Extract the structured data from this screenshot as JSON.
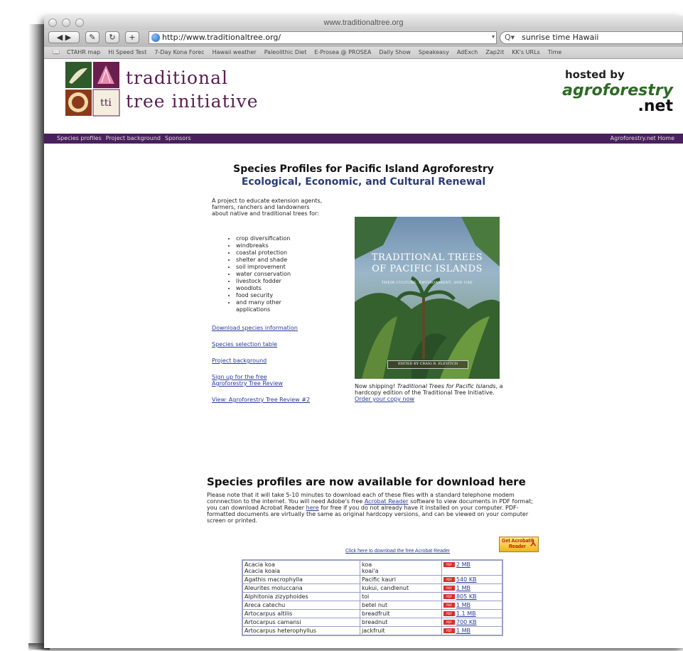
{
  "window": {
    "title": "www.traditionaltree.org",
    "back_label": "◀ ▶",
    "address": "http://www.traditionaltree.org/",
    "search": "sunrise time Hawaii"
  },
  "bookmarks": [
    "CTAHR map",
    "Hi Speed Test",
    "7-Day Kona Forec",
    "Hawaii weather",
    "Paleolithic Diet",
    "E-Prosea @ PROSEA",
    "Daily Show",
    "Speakeasy",
    "AdExch",
    "Zap2it",
    "KK's URLs",
    "Time"
  ],
  "header": {
    "logo_line1": "traditional",
    "logo_line2": "tree initiative",
    "hosted_by": "hosted by",
    "agro_name": "agroforestry",
    "agro_tld": ".net"
  },
  "nav": {
    "items": [
      "Species profiles",
      "Project background",
      "Sponsors"
    ],
    "right": "Agroforestry.net Home"
  },
  "main": {
    "title": "Species Profiles for Pacific Island Agroforestry",
    "subtitle": "Ecological, Economic, and Cultural Renewal",
    "intro": "A project to educate extension agents, farmers, ranchers and landowners about native and traditional trees for:",
    "uses": [
      "crop diversification",
      "windbreaks",
      "coastal protection",
      "shelter and shade",
      "soil improvement",
      "water conservation",
      "livestock fodder",
      "woodlots",
      "food security",
      "and many other applications"
    ],
    "links": [
      "Download species information",
      "Species selection table",
      "Project background",
      "Sign up for the free Agroforestry Tree Review",
      "View: Agroforestry Tree Review #2"
    ]
  },
  "book": {
    "title": "TRADITIONAL TREES OF PACIFIC ISLANDS",
    "subtitle": "THEIR CULTURE, ENVIRONMENT, AND USE",
    "editor": "EDITED BY CRAIG R. ELEVITCH",
    "caption_prefix": "Now shipping! ",
    "caption_title": "Traditional Trees for Pacific Islands",
    "caption_mid": ", a hardcopy edition of the Traditional Tree Initiative. ",
    "caption_link": "Order your copy now"
  },
  "download": {
    "title": "Species profiles are now available for download here",
    "note_1": "Please note that it will take 5-10 minutes to download each of these files with a standard telephone modem connnection to the internet. You will need Adobe's free ",
    "note_link1": "Acrobat Reader",
    "note_2": " software to view documents in PDF format; you can download Acrobat Reader ",
    "note_link2": "here",
    "note_3": " for free if you do not already have it installed on your computer. PDF-formatted documents are virtually the same as original hardcopy versions, and can be viewed on your computer screen or printed.",
    "acrobat_link": "Click here to download the free Acrobat Reader",
    "acrobat_badge_1": "Get Acrobat®",
    "acrobat_badge_2": "Reader",
    "pdf_badge": "PDF"
  },
  "species": [
    {
      "sci": "Acacia koa\nAcacia koaia",
      "common": "koa\nkoai'a",
      "size": "2 MB"
    },
    {
      "sci": "Agathis macrophylla",
      "common": "Pacific kauri",
      "size": "540 KB"
    },
    {
      "sci": "Aleurites moluccana",
      "common": "kukui, candlenut",
      "size": "1 MB"
    },
    {
      "sci": "Alphitonia zizyphoides",
      "common": "toi",
      "size": "805 KB"
    },
    {
      "sci": "Areca catechu",
      "common": "betel nut",
      "size": "1 MB"
    },
    {
      "sci": "Artocarpus altilis",
      "common": "breadfruit",
      "size": "1.1 MB"
    },
    {
      "sci": "Artocarpus camansi",
      "common": "breadnut",
      "size": "700 KB"
    },
    {
      "sci": "Artocarpus heterophyllus",
      "common": "jackfruit",
      "size": "1 MB"
    }
  ],
  "colors": {
    "nav_bg": "#4a1f5e",
    "logo_purple": "#5a1d52",
    "link_blue": "#2a3b9a",
    "agro_green": "#2d6a25"
  }
}
